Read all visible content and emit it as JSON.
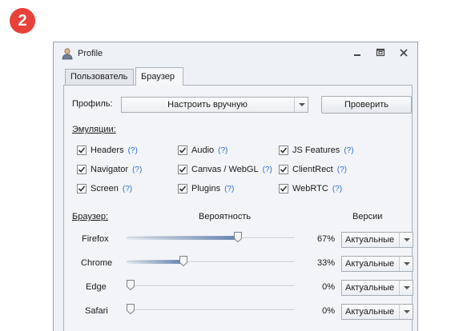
{
  "step_badge": "2",
  "window": {
    "title": "Profile",
    "tabs": [
      {
        "label": "Пользователь",
        "active": false
      },
      {
        "label": "Браузер",
        "active": true
      }
    ]
  },
  "profile": {
    "label": "Профиль:",
    "selected": "Настроить вручную",
    "check_button": "Проверить"
  },
  "emulations": {
    "heading": "Эмуляции:",
    "help": "(?)",
    "items": [
      {
        "label": "Headers",
        "checked": true
      },
      {
        "label": "Audio",
        "checked": true
      },
      {
        "label": "JS Features",
        "checked": true
      },
      {
        "label": "Navigator",
        "checked": true
      },
      {
        "label": "Canvas / WebGL",
        "checked": true
      },
      {
        "label": "ClientRect",
        "checked": true
      },
      {
        "label": "Screen",
        "checked": true
      },
      {
        "label": "Plugins",
        "checked": true
      },
      {
        "label": "WebRTC",
        "checked": true
      }
    ]
  },
  "browsers": {
    "heading": "Браузер:",
    "probability_header": "Вероятность",
    "versions_header": "Версии",
    "rows": [
      {
        "name": "Firefox",
        "probability": 67,
        "percent_text": "67%",
        "version": "Актуальные"
      },
      {
        "name": "Chrome",
        "probability": 33,
        "percent_text": "33%",
        "version": "Актуальные"
      },
      {
        "name": "Edge",
        "probability": 0,
        "percent_text": "0%",
        "version": "Актуальные"
      },
      {
        "name": "Safari",
        "probability": 0,
        "percent_text": "0%",
        "version": "Актуальные"
      }
    ]
  },
  "colors": {
    "badge": "#e8413a",
    "help_link": "#2f6ed6",
    "window_bg": "#eef1f6"
  }
}
